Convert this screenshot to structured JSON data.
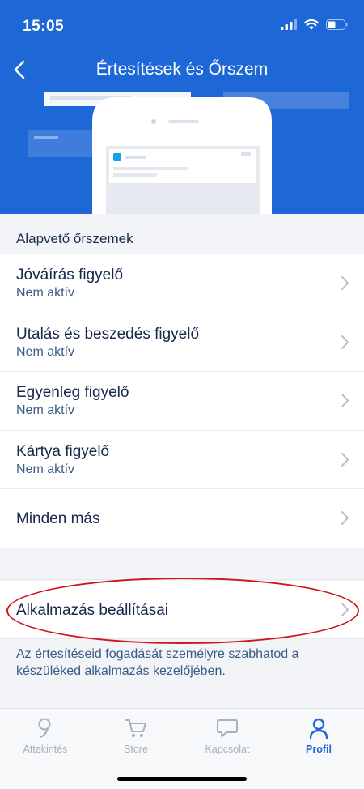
{
  "status": {
    "time": "15:05",
    "icons": [
      "cellular-signal-icon",
      "wifi-icon",
      "battery-icon"
    ]
  },
  "nav": {
    "title": "Értesítések és Őrszem",
    "back_icon": "chevron-left-icon"
  },
  "section": {
    "header": "Alapvető őrszemek"
  },
  "rows": [
    {
      "title": "Jóváírás figyelő",
      "subtitle": "Nem aktív"
    },
    {
      "title": "Utalás és beszedés figyelő",
      "subtitle": "Nem aktív"
    },
    {
      "title": "Egyenleg figyelő",
      "subtitle": "Nem aktív"
    },
    {
      "title": "Kártya figyelő",
      "subtitle": "Nem aktív"
    },
    {
      "title": "Minden más",
      "subtitle": ""
    }
  ],
  "settings": {
    "title": "Alkalmazás beállításai"
  },
  "footnote": "Az értesítéseid fogadását személyre szabhatod a készüléked alkalmazás kezelőjében.",
  "tabs": [
    {
      "label": "Áttekintés",
      "icon": "overview-icon",
      "active": false
    },
    {
      "label": "Store",
      "icon": "cart-icon",
      "active": false
    },
    {
      "label": "Kapcsolat",
      "icon": "chat-icon",
      "active": false
    },
    {
      "label": "Profil",
      "icon": "profile-icon",
      "active": true
    }
  ],
  "colors": {
    "brand": "#1e67d6",
    "highlight": "#d0141c",
    "text": "#15284a",
    "subtext": "#3b5a86"
  }
}
